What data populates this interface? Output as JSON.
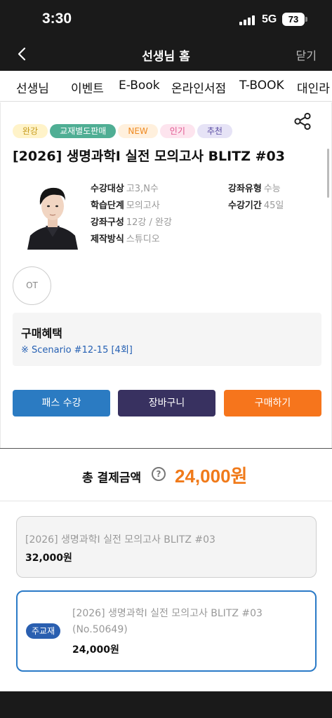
{
  "status_bar": {
    "time": "3:30",
    "network": "5G",
    "battery": "73"
  },
  "nav": {
    "back_icon": "chevron-left-icon",
    "title": "선생님 홈",
    "close_label": "닫기"
  },
  "tabs": [
    "선생님",
    "이벤트",
    "E-Book",
    "온라인서점",
    "T-BOOK",
    "대인라"
  ],
  "product": {
    "badges": [
      {
        "label": "완강",
        "bg": "#fff3c9",
        "color": "#c69a1c"
      },
      {
        "label": "교재별도판매",
        "bg": "#4fae94",
        "color": "#ffffff"
      },
      {
        "label": "NEW",
        "bg": "#fff0dd",
        "color": "#ef8a22"
      },
      {
        "label": "인기",
        "bg": "#fde4ee",
        "color": "#e0558f"
      },
      {
        "label": "추천",
        "bg": "#e6e3f6",
        "color": "#5b4da3"
      }
    ],
    "share_icon": "share-icon",
    "title": "[2026] 생명과학I 실전 모의고사 BLITZ #03",
    "info": {
      "target_label": "수강대상",
      "target_value": "고3,N수",
      "type_label": "강좌유형",
      "type_value": "수능",
      "level_label": "학습단계",
      "level_value": "모의고사",
      "period_label": "수강기간",
      "period_value": "45일",
      "composition_label": "강좌구성",
      "composition_value": "12강 / 완강",
      "production_label": "제작방식",
      "production_value": "스튜디오"
    },
    "ot_label": "OT",
    "benefit_title": "구매혜택",
    "benefit_link": "※ Scenario #12-15 [4회]",
    "buttons": {
      "pass": "패스 수강",
      "cart": "장바구니",
      "buy": "구매하기"
    },
    "colors": {
      "pass": "#2b7bc2",
      "cart": "#383160",
      "buy": "#f6751c"
    }
  },
  "total": {
    "label": "총 결제금액",
    "help_icon": "question-circle-icon",
    "help_glyph": "?",
    "price": "24,000원"
  },
  "options": [
    {
      "name": "[2026] 생명과학I 실전 모의고사 BLITZ #03",
      "price": "32,000원"
    },
    {
      "tag": "주교재",
      "name": "[2026] 생명과학I 실전 모의고사 BLITZ #03",
      "number": "(No.50649)",
      "price": "24,000원"
    }
  ]
}
